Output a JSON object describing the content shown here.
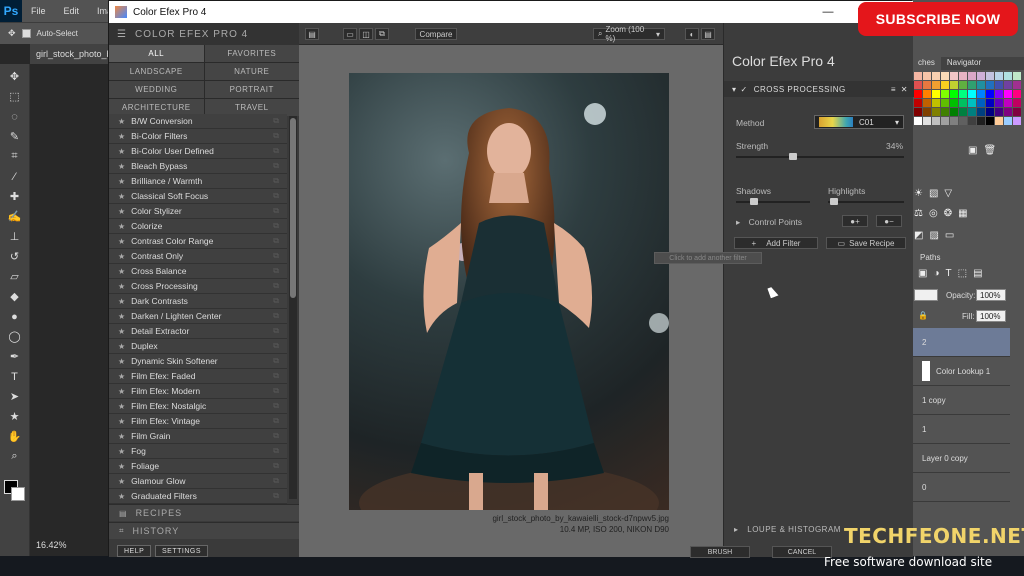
{
  "photoshop": {
    "logo": "Ps",
    "menu": [
      "File",
      "Edit",
      "Imag"
    ],
    "options_label": "Auto-Select",
    "doc_tab": "girl_stock_photo_b",
    "zoom": "16.42%",
    "right_tabs": [
      "ches",
      "Navigator"
    ],
    "paths_tab": "Paths",
    "opacity_label": "Opacity:",
    "opacity_value": "100%",
    "fill_label": "Fill:",
    "fill_value": "100%",
    "layers": [
      {
        "name": "2",
        "selected": true
      },
      {
        "name": "Color Lookup 1",
        "selected": false
      },
      {
        "name": "1 copy",
        "selected": false
      },
      {
        "name": "1",
        "selected": false
      },
      {
        "name": "Layer 0 copy",
        "selected": false
      },
      {
        "name": "0",
        "selected": false
      }
    ],
    "swatch_colors": [
      "#f4b6a3",
      "#f8c4a8",
      "#f9d0b0",
      "#fcdcb8",
      "#f3c7c7",
      "#e9b4c4",
      "#dba8c8",
      "#cfb0d8",
      "#c3c3e0",
      "#b8d4e8",
      "#b0e0e0",
      "#c0e8c8",
      "#e05050",
      "#e87840",
      "#f0a030",
      "#f8d020",
      "#c0d030",
      "#60b040",
      "#30a070",
      "#2090a0",
      "#2070c0",
      "#4050b0",
      "#7040a0",
      "#a03090",
      "#ff0000",
      "#ff8000",
      "#ffff00",
      "#80ff00",
      "#00ff00",
      "#00ff80",
      "#00ffff",
      "#0080ff",
      "#0000ff",
      "#8000ff",
      "#ff00ff",
      "#ff0080",
      "#c00000",
      "#c06000",
      "#c0c000",
      "#60c000",
      "#00c000",
      "#00c060",
      "#00c0c0",
      "#0060c0",
      "#0000c0",
      "#6000c0",
      "#c000c0",
      "#c00060",
      "#800000",
      "#804000",
      "#808000",
      "#408000",
      "#008000",
      "#008040",
      "#008080",
      "#004080",
      "#000080",
      "#400080",
      "#800080",
      "#800040",
      "#ffffff",
      "#e0e0e0",
      "#c0c0c0",
      "#a0a0a0",
      "#808080",
      "#606060",
      "#404040",
      "#202020",
      "#000000",
      "#ffcc99",
      "#99ccff",
      "#cc99ff"
    ]
  },
  "window": {
    "title": "Color Efex Pro 4",
    "minimize": "—",
    "maximize": "☐",
    "close": "✕"
  },
  "left_panel": {
    "header": "COLOR EFEX PRO 4",
    "categories": [
      "ALL",
      "FAVORITES",
      "LANDSCAPE",
      "NATURE",
      "WEDDING",
      "PORTRAIT",
      "ARCHITECTURE",
      "TRAVEL"
    ],
    "filters": [
      "B/W Conversion",
      "Bi-Color Filters",
      "Bi-Color User Defined",
      "Bleach Bypass",
      "Brilliance / Warmth",
      "Classical Soft Focus",
      "Color Stylizer",
      "Colorize",
      "Contrast Color Range",
      "Contrast Only",
      "Cross Balance",
      "Cross Processing",
      "Dark Contrasts",
      "Darken / Lighten Center",
      "Detail Extractor",
      "Duplex",
      "Dynamic Skin Softener",
      "Film Efex: Faded",
      "Film Efex: Modern",
      "Film Efex: Nostalgic",
      "Film Efex: Vintage",
      "Film Grain",
      "Fog",
      "Foliage",
      "Glamour Glow",
      "Graduated Filters"
    ],
    "recipes": "RECIPES",
    "history": "HISTORY",
    "help": "HELP",
    "settings": "SETTINGS"
  },
  "toolbar": {
    "compare": "Compare",
    "zoom": "Zoom (100 %)"
  },
  "preview": {
    "filename": "girl_stock_photo_by_kawaielli_stock-d7npwv5.jpg",
    "meta": "10.4 MP, ISO 200, NIKON D90"
  },
  "right_panel": {
    "brand": "Color Efex Pro",
    "brand_num": "4",
    "filter_name": "CROSS PROCESSING",
    "method_label": "Method",
    "method_value": "C01",
    "strength_label": "Strength",
    "strength_value": "34%",
    "strength_fraction": 0.34,
    "shadows_label": "Shadows",
    "highlights_label": "Highlights",
    "control_points": "Control Points",
    "add_filter": "Add Filter",
    "save_recipe": "Save Recipe",
    "tooltip": "Click to add another filter",
    "loupe": "LOUPE & HISTOGRAM",
    "brush": "BRUSH",
    "cancel": "CANCEL"
  },
  "overlay": {
    "subscribe": "SUBSCRIBE NOW",
    "site": "TECHFEONE.NET",
    "tagline": "Free software download site"
  }
}
